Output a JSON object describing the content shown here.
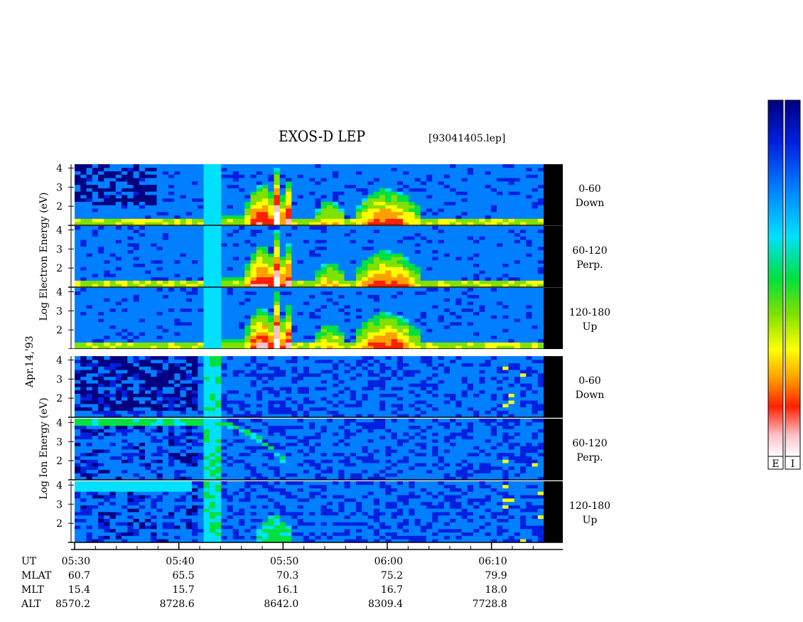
{
  "chart_data": {
    "type": "heatmap",
    "title": "EXOS-D LEP",
    "file_label": "[93041405.lep]",
    "date_label": "Apr.14,'93",
    "time_axis": {
      "range_minutes": [
        0,
        45
      ],
      "ticks": [
        {
          "t": 0,
          "ut": "05:30",
          "mlat": "60.7",
          "mlt": "15.4",
          "alt": "8570.2"
        },
        {
          "t": 10,
          "ut": "05:40",
          "mlat": "65.5",
          "mlt": "15.7",
          "alt": "8728.6"
        },
        {
          "t": 20,
          "ut": "05:50",
          "mlat": "70.3",
          "mlt": "16.1",
          "alt": "8642.0"
        },
        {
          "t": 30,
          "ut": "06:00",
          "mlat": "75.2",
          "mlt": "16.7",
          "alt": "8309.4"
        },
        {
          "t": 40,
          "ut": "06:10",
          "mlat": "79.9",
          "mlt": "18.0",
          "alt": "7728.8"
        }
      ],
      "row_labels": [
        "UT",
        "MLAT",
        "MLT",
        "ALT"
      ]
    },
    "energy_axis": {
      "scale": "log10 (eV)",
      "range": [
        1,
        4.2
      ],
      "ticks": [
        "2",
        "3",
        "4"
      ]
    },
    "groups": [
      {
        "species": "Electron",
        "ylabel_words": [
          "Log",
          "Electron",
          "Energy",
          "(eV)"
        ],
        "panels": [
          {
            "pitch_angle": "0-60",
            "direction": "Down"
          },
          {
            "pitch_angle": "60-120",
            "direction": "Perp."
          },
          {
            "pitch_angle": "120-180",
            "direction": "Up"
          }
        ]
      },
      {
        "species": "Ion",
        "ylabel_words": [
          "Log",
          "Ion",
          "Energy",
          "(eV)"
        ],
        "panels": [
          {
            "pitch_angle": "0-60",
            "direction": "Down"
          },
          {
            "pitch_angle": "60-120",
            "direction": "Perp."
          },
          {
            "pitch_angle": "120-180",
            "direction": "Up"
          }
        ]
      }
    ],
    "colorbars": [
      {
        "label": "E"
      },
      {
        "label": "I"
      }
    ],
    "colors": {
      "scale_low_to_high": [
        "#000080",
        "#0020e0",
        "#0080ff",
        "#00e0ff",
        "#00e040",
        "#80e000",
        "#ffff00",
        "#ffa000",
        "#ff2000",
        "#ffc0c8",
        "#ffffff"
      ]
    }
  }
}
